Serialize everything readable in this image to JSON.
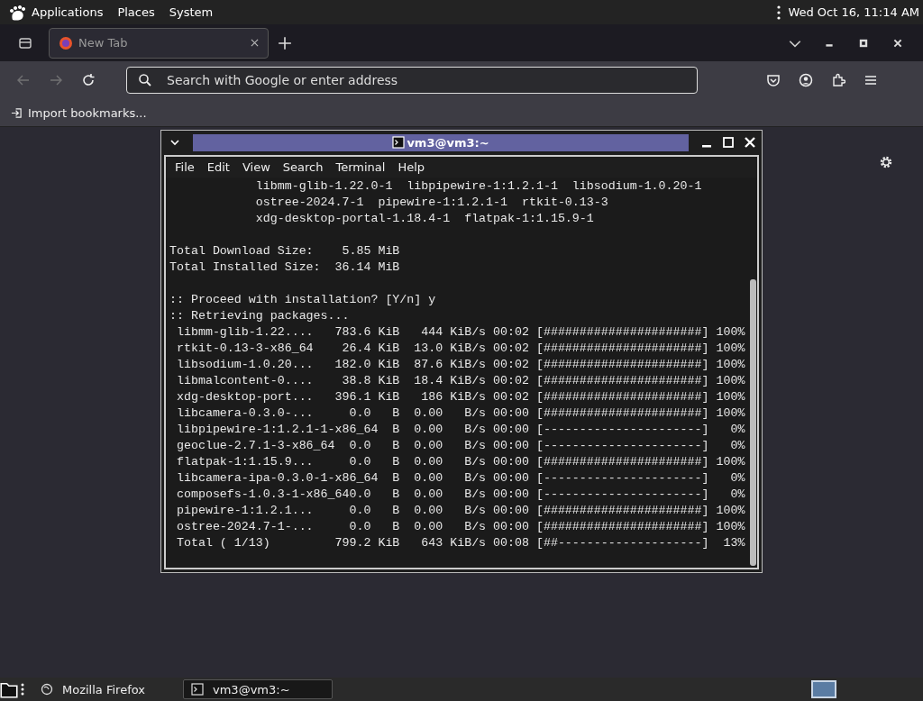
{
  "top_panel": {
    "menus": [
      "Applications",
      "Places",
      "System"
    ],
    "clock": "Wed Oct 16, 11:14 AM"
  },
  "browser": {
    "tabs": [
      {
        "label": "New Tab",
        "selected": true
      }
    ],
    "address_bar": {
      "placeholder": "Search with Google or enter address"
    },
    "bookmarks": [
      "Import bookmarks..."
    ]
  },
  "terminal": {
    "title": "vm3@vm3:~",
    "menu": [
      "File",
      "Edit",
      "View",
      "Search",
      "Terminal",
      "Help"
    ],
    "blocks": [
      [
        "            libmm-glib-1.22.0-1  libpipewire-1:1.2.1-1  libsodium-1.0.20-1",
        "            ostree-2024.7-1  pipewire-1:1.2.1-1  rtkit-0.13-3",
        "            xdg-desktop-portal-1.18.4-1  flatpak-1:1.15.9-1"
      ],
      [
        "Total Download Size:    5.85 MiB",
        "Total Installed Size:  36.14 MiB"
      ],
      [
        ":: Proceed with installation? [Y/n] y",
        ":: Retrieving packages...",
        " libmm-glib-1.22....   783.6 KiB   444 KiB/s 00:02 [######################] 100%",
        " rtkit-0.13-3-x86_64    26.4 KiB  13.0 KiB/s 00:02 [######################] 100%",
        " libsodium-1.0.20...   182.0 KiB  87.6 KiB/s 00:02 [######################] 100%",
        " libmalcontent-0....    38.8 KiB  18.4 KiB/s 00:02 [######################] 100%",
        " xdg-desktop-port...   396.1 KiB   186 KiB/s 00:02 [######################] 100%",
        " libcamera-0.3.0-...     0.0   B  0.00   B/s 00:00 [######################] 100%",
        " libpipewire-1:1.2.1-1-x86_64  B  0.00   B/s 00:00 [----------------------]   0%",
        " geoclue-2.7.1-3-x86_64  0.0   B  0.00   B/s 00:00 [----------------------]   0%",
        " flatpak-1:1.15.9...     0.0   B  0.00   B/s 00:00 [######################] 100%",
        " libcamera-ipa-0.3.0-1-x86_64  B  0.00   B/s 00:00 [----------------------]   0%",
        " composefs-1.0.3-1-x86_640.0   B  0.00   B/s 00:00 [----------------------]   0%",
        " pipewire-1:1.2.1...     0.0   B  0.00   B/s 00:00 [######################] 100%",
        " ostree-2024.7-1-...     0.0   B  0.00   B/s 00:00 [######################] 100%",
        " Total ( 1/13)         799.2 KiB   643 KiB/s 00:08 [##--------------------]  13%"
      ]
    ]
  },
  "taskbar": {
    "items": [
      {
        "label": "Mozilla Firefox",
        "selected": false
      },
      {
        "label": "vm3@vm3:~",
        "selected": true
      }
    ]
  }
}
